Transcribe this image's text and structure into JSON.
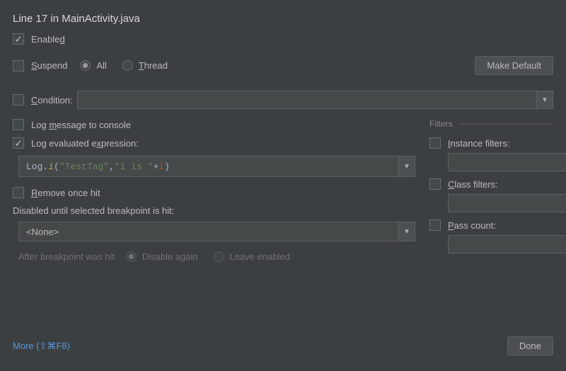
{
  "title": "Line 17 in MainActivity.java",
  "enabled_label": "Enabled",
  "suspend": {
    "label": "Suspend",
    "all": "All",
    "thread": "Thread",
    "make_default": "Make Default"
  },
  "condition_label": "Condition:",
  "log_message_label": "Log message to console",
  "log_expr_label": "Log evaluated expression:",
  "expression": {
    "prefix": "Log.",
    "method": "i",
    "open": "(",
    "arg1": "\"TestTag\"",
    "sep1": ", ",
    "arg2": "\"i is \"",
    "plus": " + ",
    "var": "i",
    "close": ")"
  },
  "remove_once_label": "Remove once hit",
  "disabled_until_label": "Disabled until selected breakpoint is hit:",
  "disabled_until_value": "<None>",
  "after_hit": {
    "label": "After breakpoint was hit",
    "disable_again": "Disable again",
    "leave_enabled": "Leave enabled"
  },
  "filters": {
    "header": "Filters",
    "instance": "Instance filters:",
    "class": "Class filters:",
    "pass_count": "Pass count:",
    "ellipsis": "..."
  },
  "footer": {
    "more": "More (⇧⌘F8)",
    "done": "Done"
  }
}
